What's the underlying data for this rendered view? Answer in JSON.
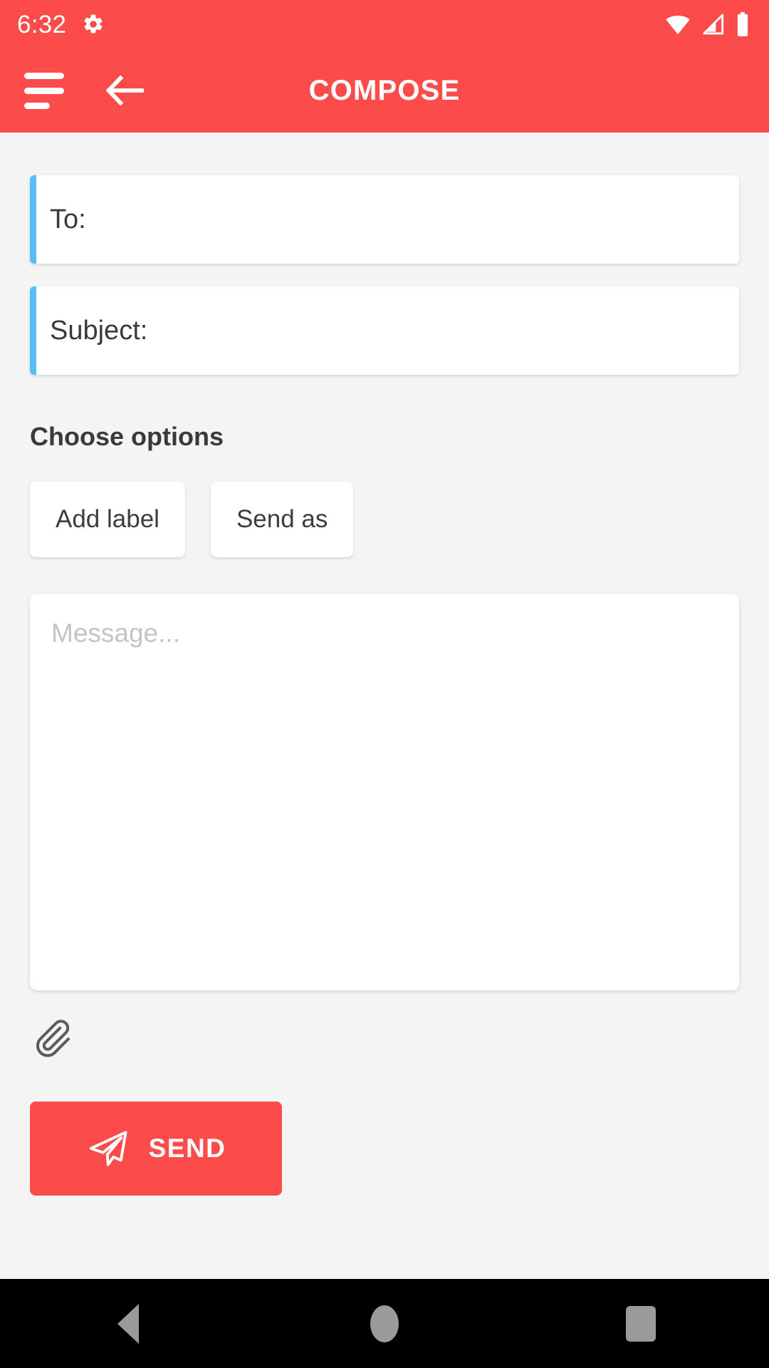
{
  "status_bar": {
    "time": "6:32",
    "icons": [
      "gear-icon",
      "wifi-icon",
      "cellular-signal-icon",
      "battery-icon"
    ],
    "wifi_level": "full",
    "cellular_level": "partial",
    "battery_level": "full"
  },
  "app_bar": {
    "menu_icon": "hamburger-menu-icon",
    "back_icon": "back-arrow-icon",
    "title": "COMPOSE"
  },
  "form": {
    "to": {
      "label": "To:",
      "value": "",
      "accent": "#56bef2"
    },
    "subject": {
      "label": "Subject:",
      "value": "",
      "accent": "#56bef2"
    }
  },
  "options": {
    "heading": "Choose options",
    "chips": [
      {
        "label": "Add label"
      },
      {
        "label": "Send as"
      }
    ]
  },
  "message": {
    "placeholder": "Message...",
    "value": ""
  },
  "attachment": {
    "icon": "paperclip-icon"
  },
  "send": {
    "label": "SEND",
    "icon": "paper-plane-icon",
    "color": "#fb4b4b"
  },
  "nav_bar": {
    "back": "nav-back-icon",
    "home": "nav-home-icon",
    "recents": "nav-recents-icon"
  },
  "theme": {
    "primary": "#fb4b4b",
    "accent_blue": "#56bef2",
    "background": "#f4f4f4",
    "card": "#ffffff",
    "text": "#3a3a3a",
    "placeholder": "#c4c4c4",
    "nav_icon": "#9a9a9a"
  }
}
